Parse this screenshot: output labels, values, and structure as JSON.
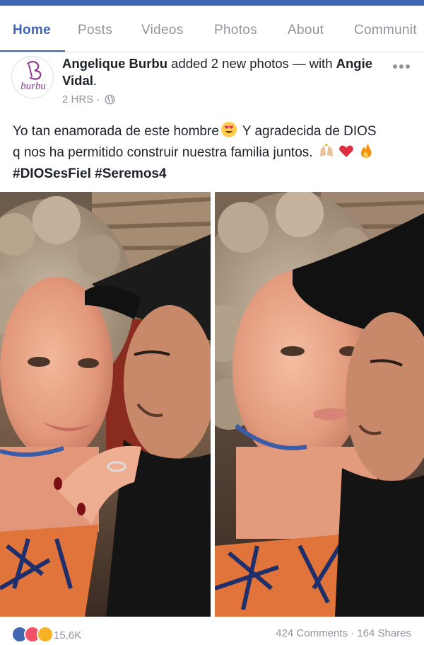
{
  "tabs": [
    {
      "label": "Home",
      "active": true
    },
    {
      "label": "Posts",
      "active": false
    },
    {
      "label": "Videos",
      "active": false
    },
    {
      "label": "Photos",
      "active": false
    },
    {
      "label": "About",
      "active": false
    },
    {
      "label": "Communit",
      "active": false
    }
  ],
  "post": {
    "avatar_logo_text": "burbu",
    "author": "Angelique Burbu",
    "action_text": " added 2 new photos — with ",
    "tagged": "Angie Vidal",
    "tagged_suffix": ".",
    "time": "2 HRS",
    "separator": "·",
    "privacy_icon": "globe-icon",
    "more_icon": "more-dots-icon",
    "caption_line1": "Yo tan enamorada de este hombre",
    "caption_line1_emoji": "heart-eyes-emoji",
    "caption_line1_rest": " Y agradecida de DIOS",
    "caption_line2": "q nos ha permitido construir nuestra familia juntos. ",
    "caption_line2_emojis": [
      "raised-hands-emoji",
      "red-heart-emoji",
      "fire-emoji"
    ],
    "hashtags": "#DIOSesFiel #Seremos4",
    "photos": [
      {
        "name": "photo-couple-1"
      },
      {
        "name": "photo-couple-2"
      }
    ]
  },
  "footer": {
    "reaction_icons": [
      "like-icon",
      "love-icon",
      "haha-icon"
    ],
    "reaction_count": "15,6K",
    "comments_shares": "424 Comments · 164 Shares"
  },
  "colors": {
    "brand": "#4267b2",
    "muted": "#90949c",
    "text": "#1d2129",
    "logo_purple": "#8b3a8f"
  }
}
